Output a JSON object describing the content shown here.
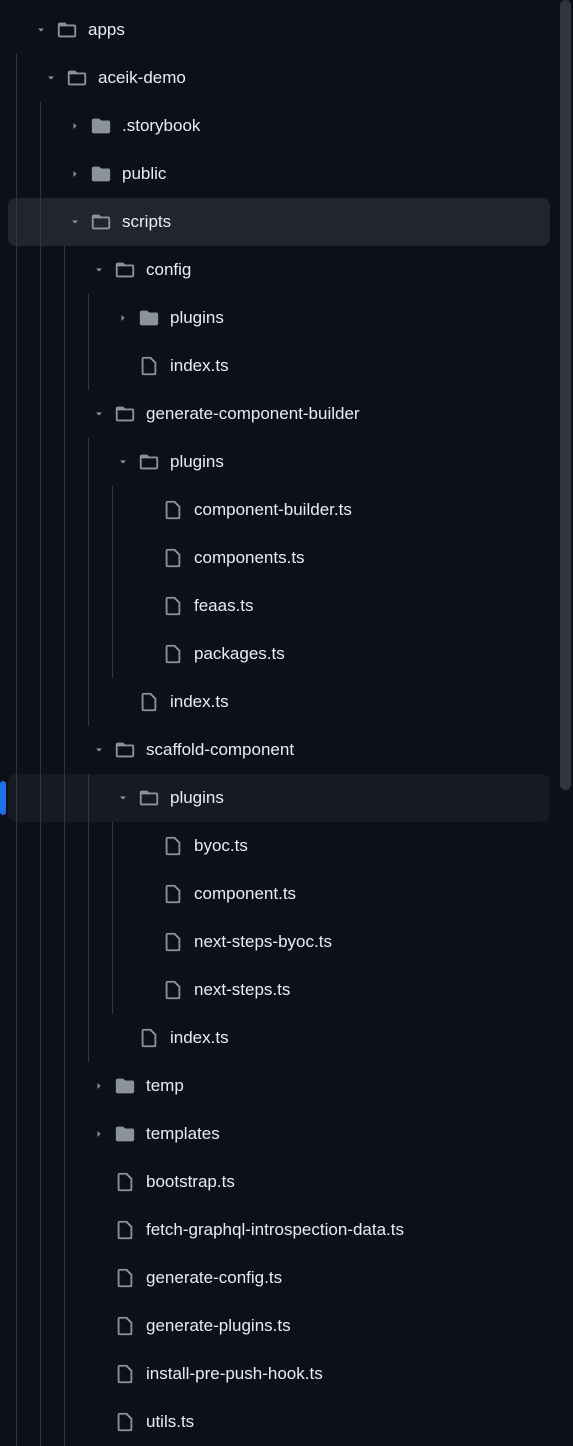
{
  "tree": [
    {
      "depth": 0,
      "type": "folder",
      "open": true,
      "label": "apps",
      "sel": false
    },
    {
      "depth": 1,
      "type": "folder",
      "open": true,
      "label": "aceik-demo",
      "sel": false
    },
    {
      "depth": 2,
      "type": "folder",
      "open": false,
      "label": ".storybook",
      "sel": false
    },
    {
      "depth": 2,
      "type": "folder",
      "open": false,
      "label": "public",
      "sel": false
    },
    {
      "depth": 2,
      "type": "folder",
      "open": true,
      "label": "scripts",
      "sel": true
    },
    {
      "depth": 3,
      "type": "folder",
      "open": true,
      "label": "config",
      "sel": false
    },
    {
      "depth": 4,
      "type": "folder",
      "open": false,
      "label": "plugins",
      "sel": false
    },
    {
      "depth": 4,
      "type": "file",
      "open": null,
      "label": "index.ts",
      "sel": false
    },
    {
      "depth": 3,
      "type": "folder",
      "open": true,
      "label": "generate-component-builder",
      "sel": false
    },
    {
      "depth": 4,
      "type": "folder",
      "open": true,
      "label": "plugins",
      "sel": false
    },
    {
      "depth": 5,
      "type": "file",
      "open": null,
      "label": "component-builder.ts",
      "sel": false
    },
    {
      "depth": 5,
      "type": "file",
      "open": null,
      "label": "components.ts",
      "sel": false
    },
    {
      "depth": 5,
      "type": "file",
      "open": null,
      "label": "feaas.ts",
      "sel": false
    },
    {
      "depth": 5,
      "type": "file",
      "open": null,
      "label": "packages.ts",
      "sel": false
    },
    {
      "depth": 4,
      "type": "file",
      "open": null,
      "label": "index.ts",
      "sel": false
    },
    {
      "depth": 3,
      "type": "folder",
      "open": true,
      "label": "scaffold-component",
      "sel": false
    },
    {
      "depth": 4,
      "type": "folder",
      "open": true,
      "label": "plugins",
      "sel": false,
      "hov": true,
      "active": true
    },
    {
      "depth": 5,
      "type": "file",
      "open": null,
      "label": "byoc.ts",
      "sel": false
    },
    {
      "depth": 5,
      "type": "file",
      "open": null,
      "label": "component.ts",
      "sel": false
    },
    {
      "depth": 5,
      "type": "file",
      "open": null,
      "label": "next-steps-byoc.ts",
      "sel": false
    },
    {
      "depth": 5,
      "type": "file",
      "open": null,
      "label": "next-steps.ts",
      "sel": false
    },
    {
      "depth": 4,
      "type": "file",
      "open": null,
      "label": "index.ts",
      "sel": false
    },
    {
      "depth": 3,
      "type": "folder",
      "open": false,
      "label": "temp",
      "sel": false
    },
    {
      "depth": 3,
      "type": "folder",
      "open": false,
      "label": "templates",
      "sel": false
    },
    {
      "depth": 3,
      "type": "file",
      "open": null,
      "label": "bootstrap.ts",
      "sel": false
    },
    {
      "depth": 3,
      "type": "file",
      "open": null,
      "label": "fetch-graphql-introspection-data.ts",
      "sel": false
    },
    {
      "depth": 3,
      "type": "file",
      "open": null,
      "label": "generate-config.ts",
      "sel": false
    },
    {
      "depth": 3,
      "type": "file",
      "open": null,
      "label": "generate-plugins.ts",
      "sel": false
    },
    {
      "depth": 3,
      "type": "file",
      "open": null,
      "label": "install-pre-push-hook.ts",
      "sel": false
    },
    {
      "depth": 3,
      "type": "file",
      "open": null,
      "label": "utils.ts",
      "sel": false
    }
  ]
}
